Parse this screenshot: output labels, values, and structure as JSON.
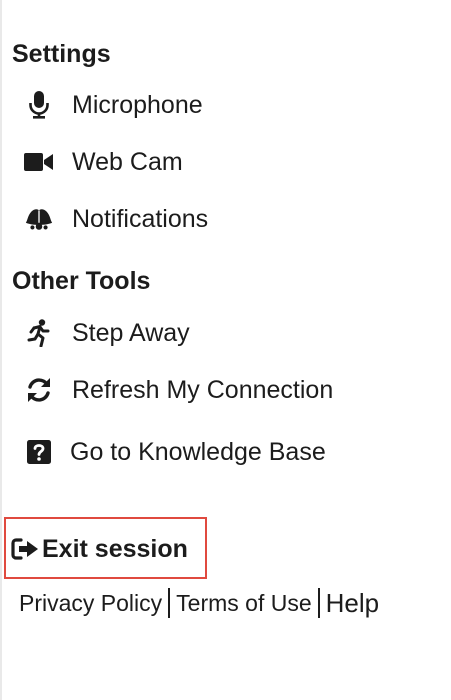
{
  "settings": {
    "heading": "Settings",
    "items": [
      {
        "label": "Microphone",
        "icon": "microphone-icon"
      },
      {
        "label": "Web Cam",
        "icon": "video-camera-icon"
      },
      {
        "label": "Notifications",
        "icon": "bells-icon"
      }
    ]
  },
  "other_tools": {
    "heading": "Other Tools",
    "items": [
      {
        "label": "Step Away",
        "icon": "running-person-icon"
      },
      {
        "label": "Refresh My Connection",
        "icon": "refresh-icon"
      },
      {
        "label": "Go to Knowledge Base",
        "icon": "question-square-icon"
      }
    ]
  },
  "exit": {
    "label": "Exit session",
    "icon": "sign-out-icon",
    "highlight_color": "#e04a3f"
  },
  "footer": {
    "privacy": "Privacy Policy",
    "terms": "Terms of Use",
    "help": "Help"
  },
  "colors": {
    "text": "#1c1c1c",
    "background": "#ffffff"
  }
}
